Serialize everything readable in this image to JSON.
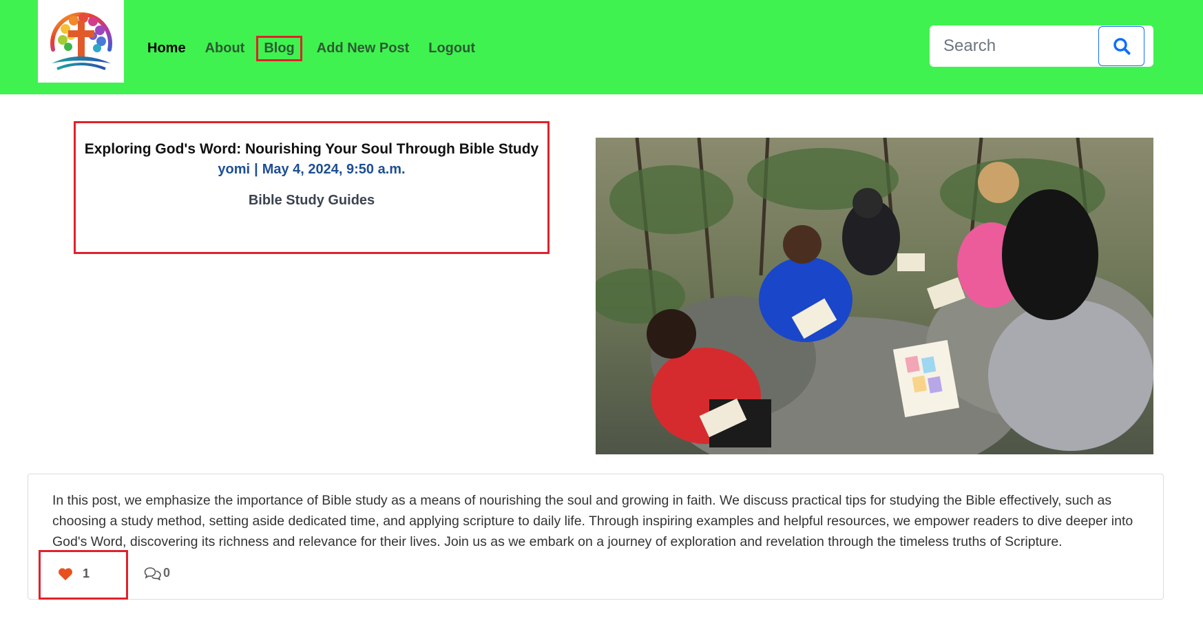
{
  "navbar": {
    "background": "#40f24f",
    "logo_icon": "cross-tree-logo-icon",
    "links": [
      {
        "label": "Home",
        "state": "active"
      },
      {
        "label": "About"
      },
      {
        "label": "Blog",
        "state": "highlighted"
      },
      {
        "label": "Add New Post"
      },
      {
        "label": "Logout"
      }
    ],
    "search": {
      "placeholder": "Search",
      "button_icon": "search-icon"
    }
  },
  "post": {
    "title": "Exploring God's Word: Nourishing Your Soul Through Bible Study",
    "author": "yomi",
    "separator": "|",
    "date": "May 4, 2024, 9:50 a.m.",
    "category": "Bible Study Guides",
    "image_icon": "bible-study-group-photo",
    "body": "In this post, we emphasize the importance of Bible study as a means of nourishing the soul and growing in faith. We discuss practical tips for studying the Bible effectively, such as choosing a study method, setting aside dedicated time, and applying scripture to daily life. Through inspiring examples and helpful resources, we empower readers to dive deeper into God's Word, discovering its richness and relevance for their lives. Join us as we embark on a journey of exploration and revelation through the timeless truths of Scripture."
  },
  "reactions": {
    "likes": "1",
    "like_icon": "heart-icon",
    "like_color": "#e8501e",
    "comments": "0",
    "comment_icon": "comments-icon"
  },
  "colors": {
    "highlight_border": "#e0212a",
    "meta_blue": "#1d4e94",
    "search_button_blue": "#0d6efd"
  }
}
